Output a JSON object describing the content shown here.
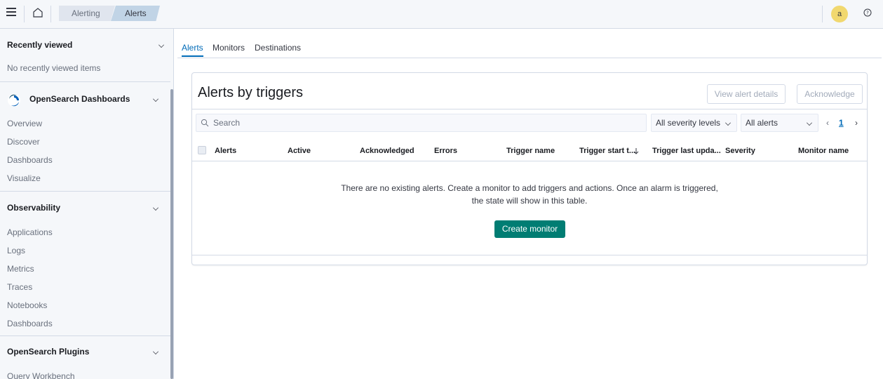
{
  "header": {
    "breadcrumbs": [
      "Alerting",
      "Alerts"
    ],
    "avatar_initial": "a"
  },
  "sidebar": {
    "recently_viewed": {
      "title": "Recently viewed",
      "empty_text": "No recently viewed items"
    },
    "opensearch_dashboards": {
      "title": "OpenSearch Dashboards",
      "items": [
        "Overview",
        "Discover",
        "Dashboards",
        "Visualize"
      ]
    },
    "observability": {
      "title": "Observability",
      "items": [
        "Applications",
        "Logs",
        "Metrics",
        "Traces",
        "Notebooks",
        "Dashboards"
      ]
    },
    "opensearch_plugins": {
      "title": "OpenSearch Plugins",
      "items": [
        "Query Workbench"
      ]
    }
  },
  "tabs": [
    "Alerts",
    "Monitors",
    "Destinations"
  ],
  "panel": {
    "title": "Alerts by triggers",
    "view_details_label": "View alert details",
    "acknowledge_label": "Acknowledge",
    "search_placeholder": "Search",
    "severity_select": "All severity levels",
    "alerts_select": "All alerts",
    "current_page": "1",
    "columns": [
      "Alerts",
      "Active",
      "Acknowledged",
      "Errors",
      "Trigger name",
      "Trigger start t...",
      "Trigger last upda...",
      "Severity",
      "Monitor name"
    ],
    "empty_line1": "There are no existing alerts. Create a monitor to add triggers and actions. Once an alarm is triggered,",
    "empty_line2": "the state will show in this table.",
    "create_label": "Create monitor"
  },
  "colors": {
    "accent": "#006bb8",
    "primary_button": "#017d73",
    "avatar_bg": "#f1d86f"
  }
}
